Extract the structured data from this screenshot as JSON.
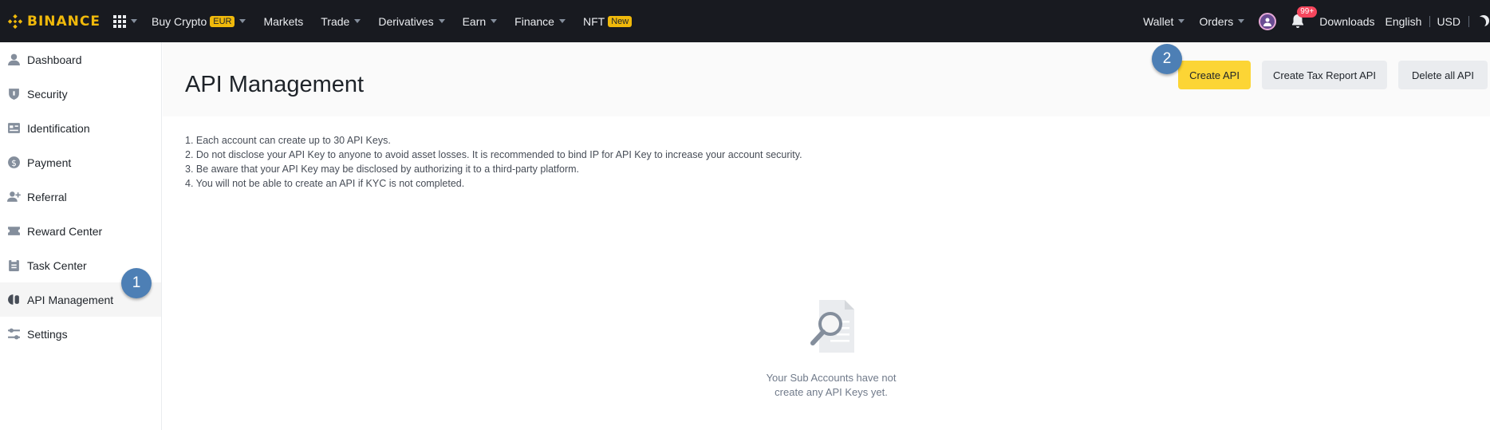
{
  "brand": {
    "name": "BINANCE",
    "color": "#f0b90b"
  },
  "topnav": {
    "left_items": [
      {
        "label": "Buy Crypto",
        "pill": "EUR",
        "has_caret": true
      },
      {
        "label": "Markets",
        "has_caret": false
      },
      {
        "label": "Trade",
        "has_caret": true
      },
      {
        "label": "Derivatives",
        "has_caret": true
      },
      {
        "label": "Earn",
        "has_caret": true
      },
      {
        "label": "Finance",
        "has_caret": true
      },
      {
        "label": "NFT",
        "pill": "New",
        "has_caret": false
      }
    ],
    "right_items": {
      "wallet": "Wallet",
      "orders": "Orders",
      "notifications_badge": "99+",
      "downloads": "Downloads",
      "language": "English",
      "currency": "USD"
    }
  },
  "sidebar": {
    "items": [
      {
        "label": "Dashboard",
        "icon": "user-icon",
        "active": false
      },
      {
        "label": "Security",
        "icon": "shield-icon",
        "active": false
      },
      {
        "label": "Identification",
        "icon": "id-card-icon",
        "active": false
      },
      {
        "label": "Payment",
        "icon": "dollar-icon",
        "active": false
      },
      {
        "label": "Referral",
        "icon": "add-user-icon",
        "active": false
      },
      {
        "label": "Reward Center",
        "icon": "ticket-icon",
        "active": false
      },
      {
        "label": "Task Center",
        "icon": "clipboard-icon",
        "active": false
      },
      {
        "label": "API Management",
        "icon": "api-icon",
        "active": true
      },
      {
        "label": "Settings",
        "icon": "sliders-icon",
        "active": false
      }
    ]
  },
  "main": {
    "title": "API Management",
    "buttons": {
      "create_api": "Create API",
      "create_tax_report_api": "Create Tax Report API",
      "delete_all_api": "Delete all API"
    },
    "notes": [
      "1. Each account can create up to 30 API Keys.",
      "2. Do not disclose your API Key to anyone to avoid asset losses. It is recommended to bind IP for API Key to increase your account security.",
      "3. Be aware that your API Key may be disclosed by authorizing it to a third-party platform.",
      "4. You will not be able to create an API if KYC is not completed."
    ],
    "empty_state": {
      "line1": "Your Sub Accounts have not",
      "line2": "create any API Keys yet.",
      "icon": "search-document-icon"
    }
  },
  "annotations": {
    "step1": "1",
    "step2": "2",
    "color": "#4d7fb5"
  }
}
